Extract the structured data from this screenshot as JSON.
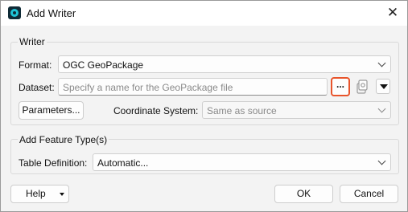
{
  "window": {
    "title": "Add Writer",
    "close_glyph": "✕"
  },
  "writer": {
    "group_label": "Writer",
    "format_label": "Format:",
    "format_value": "OGC GeoPackage",
    "dataset_label": "Dataset:",
    "dataset_placeholder": "Specify a name for the GeoPackage file",
    "browse_label": "...",
    "parameters_label": "Parameters...",
    "coord_label": "Coordinate System:",
    "coord_value": "Same as source"
  },
  "feature_types": {
    "group_label": "Add Feature Type(s)",
    "table_def_label": "Table Definition:",
    "table_def_value": "Automatic..."
  },
  "footer": {
    "help_label": "Help",
    "ok_label": "OK",
    "cancel_label": "Cancel"
  },
  "colors": {
    "browse_highlight": "#e8542b",
    "app_icon": "#1ec3d6"
  }
}
